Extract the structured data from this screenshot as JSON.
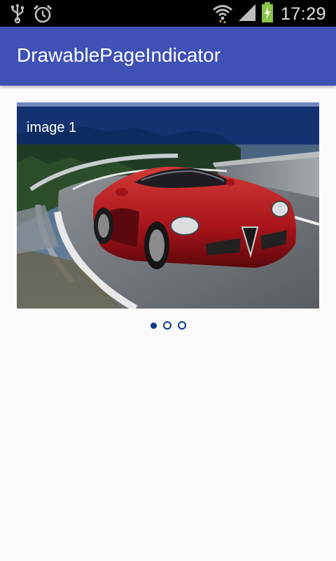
{
  "status_bar": {
    "time": "17:29",
    "icons": [
      "usb-icon",
      "alarm-clock-icon",
      "wifi-icon",
      "signal-icon",
      "battery-charging-icon"
    ]
  },
  "app_bar": {
    "title": "DrawablePageIndicator",
    "color": "#3f51b5"
  },
  "pager": {
    "pages": [
      {
        "caption": "image 1",
        "image": "red-sports-car-on-mountain-road"
      }
    ],
    "current_page": 1,
    "page_count": 3
  },
  "indicator": {
    "color": "#0d3a8c",
    "dots": [
      {
        "state": "active"
      },
      {
        "state": "inactive"
      },
      {
        "state": "inactive"
      }
    ]
  }
}
